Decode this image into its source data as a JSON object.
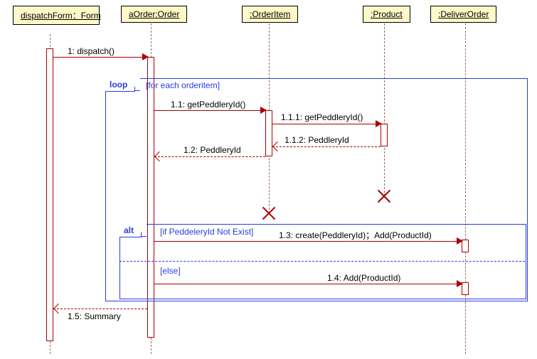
{
  "diagram": {
    "lifelines": {
      "l1": "dispatchForm：Form",
      "l2": "aOrder:Order",
      "l3": ":OrderItem",
      "l4": ":Product",
      "l5": ":DeliverOrder"
    },
    "fragments": {
      "loop": {
        "name": "loop",
        "guard": "[for each orderitem]"
      },
      "alt": {
        "name": "alt",
        "guard1": "[if PeddeleryId Not Exist]",
        "guard2": "[else]"
      }
    },
    "messages": {
      "m1": "1: dispatch()",
      "m11": "1.1: getPeddleryId()",
      "m111": "1.1.1: getPeddleryId()",
      "m112": "1.1.2: PeddleryId",
      "m12": "1.2: PeddleryId",
      "m13": "1.3: create(PeddleryId)；Add(ProductId)",
      "m14": "1.4: Add(ProductId)",
      "m15": "1.5: Summary"
    }
  },
  "chart_data": {
    "type": "sequence_diagram",
    "lifelines": [
      {
        "id": "dispatchForm",
        "label": "dispatchForm：Form"
      },
      {
        "id": "aOrder",
        "label": "aOrder:Order"
      },
      {
        "id": "OrderItem",
        "label": ":OrderItem"
      },
      {
        "id": "Product",
        "label": ":Product"
      },
      {
        "id": "DeliverOrder",
        "label": ":DeliverOrder"
      }
    ],
    "fragments": [
      {
        "type": "loop",
        "guard": "for each orderitem",
        "contains": [
          "1.1",
          "1.1.1",
          "1.1.2",
          "1.2",
          "1.3",
          "1.4"
        ]
      },
      {
        "type": "alt",
        "operands": [
          {
            "guard": "if PeddeleryId Not Exist",
            "contains": [
              "1.3"
            ]
          },
          {
            "guard": "else",
            "contains": [
              "1.4"
            ]
          }
        ]
      }
    ],
    "messages": [
      {
        "seq": "1",
        "from": "dispatchForm",
        "to": "aOrder",
        "label": "dispatch()",
        "kind": "call"
      },
      {
        "seq": "1.1",
        "from": "aOrder",
        "to": "OrderItem",
        "label": "getPeddleryId()",
        "kind": "call"
      },
      {
        "seq": "1.1.1",
        "from": "OrderItem",
        "to": "Product",
        "label": "getPeddleryId()",
        "kind": "call"
      },
      {
        "seq": "1.1.2",
        "from": "Product",
        "to": "OrderItem",
        "label": "PeddleryId",
        "kind": "return"
      },
      {
        "seq": "1.2",
        "from": "OrderItem",
        "to": "aOrder",
        "label": "PeddleryId",
        "kind": "return"
      },
      {
        "seq": "1.3",
        "from": "aOrder",
        "to": "DeliverOrder",
        "label": "create(PeddleryId)；Add(ProductId)",
        "kind": "call"
      },
      {
        "seq": "1.4",
        "from": "aOrder",
        "to": "DeliverOrder",
        "label": "Add(ProductId)",
        "kind": "call"
      },
      {
        "seq": "1.5",
        "from": "aOrder",
        "to": "dispatchForm",
        "label": "Summary",
        "kind": "return"
      }
    ],
    "destroyed": [
      "OrderItem",
      "Product"
    ]
  }
}
